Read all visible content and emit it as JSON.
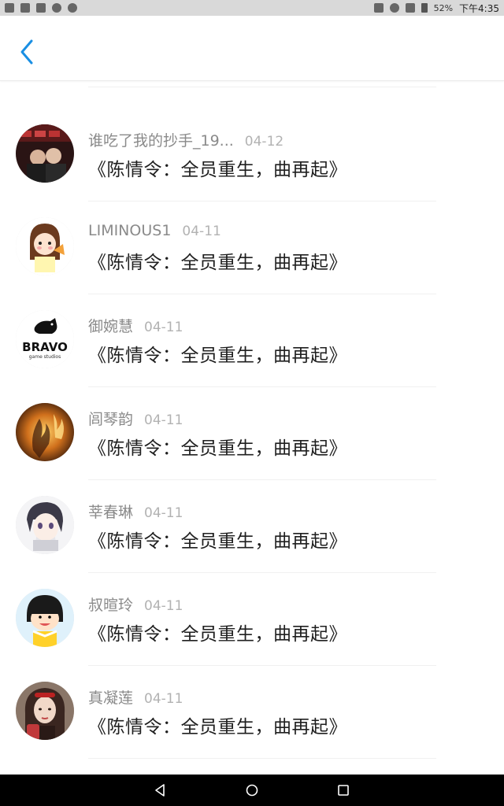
{
  "status_bar": {
    "battery_level": "52%",
    "time": "下午4:35",
    "left_icons": [
      "wechat-icon",
      "app-icon",
      "image-icon",
      "circle-icon",
      "weibo-icon"
    ],
    "right_icons": [
      "vibrate-icon",
      "alarm-icon",
      "wifi-icon",
      "battery-icon"
    ]
  },
  "header": {
    "back_icon": "chevron-left-icon",
    "accent_color": "#1a8fe3"
  },
  "list": {
    "items": [
      {
        "name": "谁吃了我的抄手_19...",
        "date": "04-12",
        "message": "《陈情令：全员重生，曲再起》",
        "avatar": "avatar-photo-couple"
      },
      {
        "name": "LIMINOUS1",
        "date": "04-11",
        "message": "《陈情令：全员重生，曲再起》",
        "avatar": "avatar-cartoon-girl"
      },
      {
        "name": "御婉慧",
        "date": "04-11",
        "message": "《陈情令：全员重生，曲再起》",
        "avatar": "avatar-bravo-logo"
      },
      {
        "name": "闾琴韵",
        "date": "04-11",
        "message": "《陈情令：全员重生，曲再起》",
        "avatar": "avatar-fire-photo"
      },
      {
        "name": "莘春琳",
        "date": "04-11",
        "message": "《陈情令：全员重生，曲再起》",
        "avatar": "avatar-anime-boy"
      },
      {
        "name": "叔暄玲",
        "date": "04-11",
        "message": "《陈情令：全员重生，曲再起》",
        "avatar": "avatar-chibi-girl"
      },
      {
        "name": "真凝莲",
        "date": "04-11",
        "message": "《陈情令：全员重生，曲再起》",
        "avatar": "avatar-portrait-girl"
      }
    ]
  },
  "bravo_logo": {
    "word": "BRAVO",
    "tagline": "game studios"
  },
  "nav_bar": {
    "buttons": [
      "back-triangle-icon",
      "home-circle-icon",
      "recents-square-icon"
    ]
  }
}
